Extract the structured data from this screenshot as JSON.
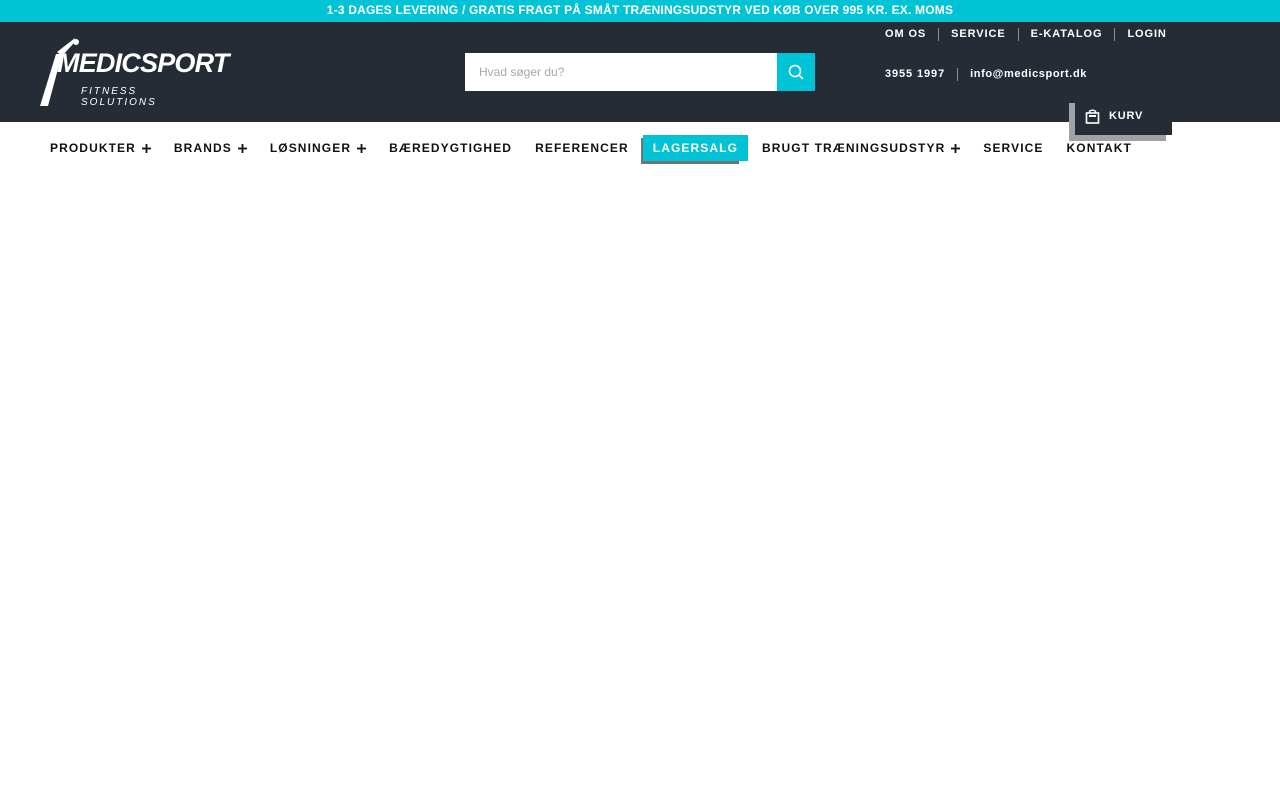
{
  "promo": {
    "text": "1-3 DAGES LEVERING / GRATIS FRAGT PÅ SMÅT TRÆNINGSUDSTYR VED KØB OVER 995 KR. EX. MOMS"
  },
  "brand": {
    "name": "MEDICSPORT",
    "tagline": "FITNESS SOLUTIONS"
  },
  "search": {
    "placeholder": "Hvad søger du?",
    "value": ""
  },
  "top_links": [
    "OM OS",
    "SERVICE",
    "E-KATALOG",
    "LOGIN"
  ],
  "contact": {
    "phone": "3955 1997",
    "email": "info@medicsport.dk"
  },
  "cart": {
    "label": "KURV",
    "icon": "shopping-bag-icon"
  },
  "nav": {
    "items": [
      {
        "label": "PRODUKTER",
        "has_submenu": true
      },
      {
        "label": "BRANDS",
        "has_submenu": true
      },
      {
        "label": "LØSNINGER",
        "has_submenu": true
      },
      {
        "label": "BÆREDYGTIGHED",
        "has_submenu": false
      },
      {
        "label": "REFERENCER",
        "has_submenu": false
      },
      {
        "label": "LAGERSALG",
        "has_submenu": false,
        "highlighted": true
      },
      {
        "label": "BRUGT TRÆNINGSUDSTYR",
        "has_submenu": true
      },
      {
        "label": "SERVICE",
        "has_submenu": false
      },
      {
        "label": "KONTAKT",
        "has_submenu": false
      }
    ]
  },
  "colors": {
    "accent": "#00c4d6",
    "header_bg": "#262c36",
    "text_dark": "#111111",
    "white": "#ffffff"
  }
}
